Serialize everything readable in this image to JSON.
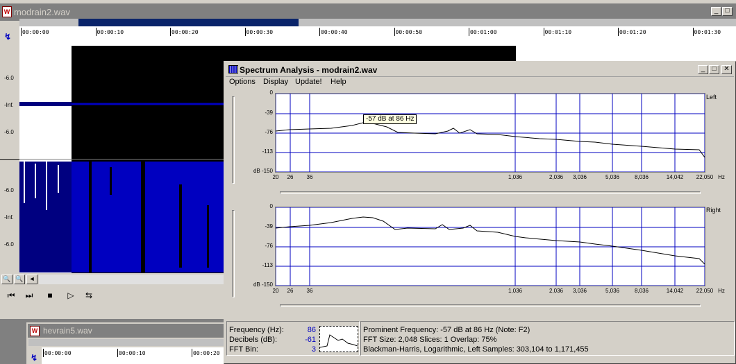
{
  "main_window": {
    "title": "modrain2.wav",
    "timeline": [
      "00:00:00",
      "00:00:10",
      "00:00:20",
      "00:00:30",
      "00:00:40",
      "00:00:50",
      "00:01:00",
      "00:01:10",
      "00:01:20",
      "00:01:30"
    ],
    "db_top": [
      "-6.0",
      "-Inf.",
      "-6.0"
    ],
    "db_bottom": [
      "-6.0",
      "-Inf.",
      "-6.0"
    ]
  },
  "spectrum": {
    "title": "Spectrum Analysis - modrain2.wav",
    "menu": [
      "Options",
      "Display",
      "Update!",
      "Help"
    ],
    "ylabels": [
      "0",
      "-39",
      "-76",
      "-113",
      "-150"
    ],
    "y_unit": "dB",
    "xlabels": [
      "20",
      "26",
      "36",
      "1,036",
      "2,036",
      "3,036",
      "5,036",
      "8,036",
      "14,042",
      "22,050"
    ],
    "x_unit": "Hz",
    "left_label": "Left",
    "right_label": "Right",
    "tooltip": "-57 dB at 86 Hz",
    "status": {
      "freq_label": "Frequency (Hz):",
      "freq_value": "86",
      "db_label": "Decibels (dB):",
      "db_value": "-61",
      "bin_label": "FFT Bin:",
      "bin_value": "3",
      "line1": "Prominent Frequency: -57 dB at 86 Hz (Note: F2)",
      "line2": "FFT Size: 2,048  Slices: 1  Overlap: 75%",
      "line3": "Blackman-Harris, Logarithmic, Left  Samples: 303,104 to 1,171,455"
    }
  },
  "second_window": {
    "title": "hevrain5.wav",
    "timeline": [
      "00:00:00",
      "00:00:10",
      "00:00:20"
    ]
  },
  "colors": {
    "waveform": "#0000c0",
    "dark_wave": "#000080",
    "grid": "#0000c0",
    "selection": "#000000"
  }
}
